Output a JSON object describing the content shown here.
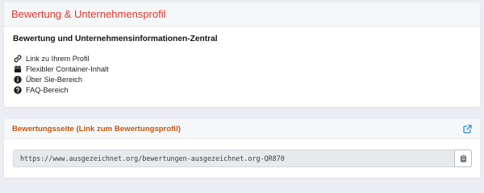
{
  "profile_card": {
    "title": "Bewertung & Unternehmensprofil",
    "heading": "Bewertung und Unternehmensinformationen-Zentral",
    "features": [
      {
        "icon": "link-icon",
        "label": "Link zu Ihrem Profil"
      },
      {
        "icon": "calendar-icon",
        "label": "Flexibler Container-Inhalt"
      },
      {
        "icon": "info-circle-icon",
        "label": "Über Sie-Bereich"
      },
      {
        "icon": "question-circle-icon",
        "label": "FAQ-Bereich"
      }
    ]
  },
  "review_page": {
    "title": "Bewertungsseite (Link zum Bewertungsprofil)",
    "url": "https://www.ausgezeichnet.org/bewertungen-ausgezeichnet.org-QR870",
    "external_link_icon": "external-link-icon",
    "copy_icon": "clipboard-icon"
  },
  "colors": {
    "accent_red": "#e0372e",
    "accent_orange": "#c4560f",
    "link_blue": "#2b86d9",
    "background": "#ebedf3"
  }
}
